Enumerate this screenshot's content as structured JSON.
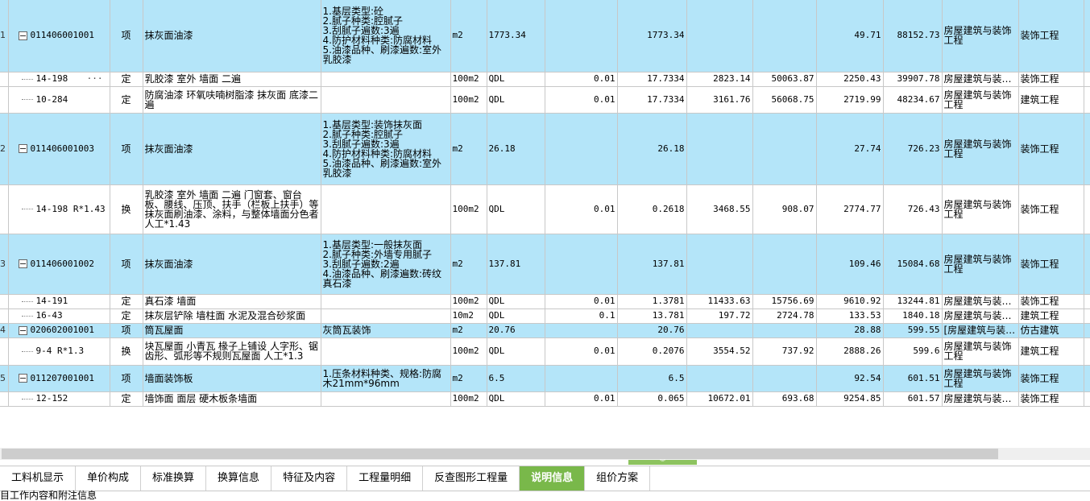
{
  "rows": [
    {
      "idx": "1",
      "hl": true,
      "node": "parent",
      "code": "011406001001",
      "cat": "项",
      "name": "抹灰面油漆",
      "feat": "1.基层类型:砼\n2.腻子种类:腔腻子\n3.刮腻子遍数:3遍\n4.防护材料种类:防腐材料\n5.油漆品种、刷漆遍数:室外乳胶漆",
      "unit": "m2",
      "expr": "1773.34",
      "coef": "",
      "qty": "1773.34",
      "price": "",
      "total": "",
      "cprice": "49.71",
      "csum": "88152.73",
      "spec": "房屋建筑与装饰工程",
      "prof": "装饰工程"
    },
    {
      "idx": "",
      "hl": false,
      "node": "child",
      "ell": "···",
      "code": "14-198",
      "cat": "定",
      "name": "乳胶漆 室外 墙面 二遍",
      "feat": "",
      "unit": "100m2",
      "expr": "QDL",
      "coef": "0.01",
      "qty": "17.7334",
      "price": "2823.14",
      "total": "50063.87",
      "cprice": "2250.43",
      "csum": "39907.78",
      "spec": "房屋建筑与装…",
      "prof": "装饰工程"
    },
    {
      "idx": "",
      "hl": false,
      "node": "child",
      "code": "10-284",
      "cat": "定",
      "name": "防腐油漆 环氧呋喃树脂漆 抹灰面 底漆二遍",
      "feat": "",
      "unit": "100m2",
      "expr": "QDL",
      "coef": "0.01",
      "qty": "17.7334",
      "price": "3161.76",
      "total": "56068.75",
      "cprice": "2719.99",
      "csum": "48234.67",
      "spec": "房屋建筑与装饰工程",
      "prof": "建筑工程"
    },
    {
      "idx": "2",
      "hl": true,
      "node": "parent",
      "code": "011406001003",
      "cat": "项",
      "name": "抹灰面油漆",
      "feat": "1.基层类型:装饰抹灰面\n2.腻子种类:腔腻子\n3.刮腻子遍数:3遍\n4.防护材料种类:防腐材料\n5.油漆品种、刷漆遍数:室外乳胶漆",
      "unit": "m2",
      "expr": "26.18",
      "coef": "",
      "qty": "26.18",
      "price": "",
      "total": "",
      "cprice": "27.74",
      "csum": "726.23",
      "spec": "房屋建筑与装饰工程",
      "prof": "装饰工程"
    },
    {
      "idx": "",
      "hl": false,
      "node": "child",
      "code": "14-198 R*1.43",
      "cat": "换",
      "name": "乳胶漆 室外 墙面 二遍  门窗套、窗台板、腰线、压顶、扶手（栏板上扶手）等抹灰面刷油漆、涂料，与整体墙面分色者 人工*1.43",
      "feat": "",
      "unit": "100m2",
      "expr": "QDL",
      "coef": "0.01",
      "qty": "0.2618",
      "price": "3468.55",
      "total": "908.07",
      "cprice": "2774.77",
      "csum": "726.43",
      "spec": "房屋建筑与装饰工程",
      "prof": "装饰工程"
    },
    {
      "idx": "3",
      "hl": true,
      "node": "parent",
      "code": "011406001002",
      "cat": "项",
      "name": "抹灰面油漆",
      "feat": "1.基层类型:一般抹灰面\n2.腻子种类:外墙专用腻子\n3.刮腻子遍数:2遍\n4.油漆品种、刷漆遍数:砖纹真石漆",
      "unit": "m2",
      "expr": "137.81",
      "coef": "",
      "qty": "137.81",
      "price": "",
      "total": "",
      "cprice": "109.46",
      "csum": "15084.68",
      "spec": "房屋建筑与装饰工程",
      "prof": "装饰工程"
    },
    {
      "idx": "",
      "hl": false,
      "node": "child",
      "code": "14-191",
      "cat": "定",
      "name": "真石漆 墙面",
      "feat": "",
      "unit": "100m2",
      "expr": "QDL",
      "coef": "0.01",
      "qty": "1.3781",
      "price": "11433.63",
      "total": "15756.69",
      "cprice": "9610.92",
      "csum": "13244.81",
      "spec": "房屋建筑与装…",
      "prof": "装饰工程"
    },
    {
      "idx": "",
      "hl": false,
      "node": "child",
      "code": "16-43",
      "cat": "定",
      "name": "抹灰层铲除 墙柱面 水泥及混合砂浆面",
      "feat": "",
      "unit": "10m2",
      "expr": "QDL",
      "coef": "0.1",
      "qty": "13.781",
      "price": "197.72",
      "total": "2724.78",
      "cprice": "133.53",
      "csum": "1840.18",
      "spec": "房屋建筑与装…",
      "prof": "建筑工程"
    },
    {
      "idx": "4",
      "hl": true,
      "node": "parent",
      "code": "020602001001",
      "cat": "项",
      "name": "筒瓦屋面",
      "feat": "灰筒瓦装饰",
      "unit": "m2",
      "expr": "20.76",
      "coef": "",
      "qty": "20.76",
      "price": "",
      "total": "",
      "cprice": "28.88",
      "csum": "599.55",
      "spec": "[房屋建筑与装…",
      "prof": "仿古建筑"
    },
    {
      "idx": "",
      "hl": false,
      "node": "child",
      "code": "9-4 R*1.3",
      "cat": "换",
      "name": "块瓦屋面 小青瓦 椽子上铺设  人字形、锯齿形、弧形等不规则瓦屋面 人工*1.3",
      "feat": "",
      "unit": "100m2",
      "expr": "QDL",
      "coef": "0.01",
      "qty": "0.2076",
      "price": "3554.52",
      "total": "737.92",
      "cprice": "2888.26",
      "csum": "599.6",
      "spec": "房屋建筑与装饰工程",
      "prof": "建筑工程"
    },
    {
      "idx": "5",
      "hl": true,
      "node": "parent",
      "code": "011207001001",
      "cat": "项",
      "name": "墙面装饰板",
      "feat": "1.压条材料种类、规格:防腐木21mm*96mm",
      "unit": "m2",
      "expr": "6.5",
      "coef": "",
      "qty": "6.5",
      "price": "",
      "total": "",
      "cprice": "92.54",
      "csum": "601.51",
      "spec": "房屋建筑与装饰工程",
      "prof": "装饰工程"
    },
    {
      "idx": "",
      "hl": false,
      "node": "child",
      "code": "12-152",
      "cat": "定",
      "name": "墙饰面 面层 硬木板条墙面",
      "feat": "",
      "unit": "100m2",
      "expr": "QDL",
      "coef": "0.01",
      "qty": "0.065",
      "price": "10672.01",
      "total": "693.68",
      "cprice": "9254.85",
      "csum": "601.57",
      "spec": "房屋建筑与装…",
      "prof": "装饰工程"
    }
  ],
  "splitter": {
    "icon": "chevron-down-icon",
    "glyph": "︾"
  },
  "tabs": [
    {
      "label": "工料机显示",
      "active": false
    },
    {
      "label": "单价构成",
      "active": false
    },
    {
      "label": "标准换算",
      "active": false
    },
    {
      "label": "换算信息",
      "active": false
    },
    {
      "label": "特征及内容",
      "active": false
    },
    {
      "label": "工程量明细",
      "active": false
    },
    {
      "label": "反查图形工程量",
      "active": false
    },
    {
      "label": "说明信息",
      "active": true
    },
    {
      "label": "组价方案",
      "active": false
    }
  ],
  "footnote": "目工作内容和附注信息"
}
